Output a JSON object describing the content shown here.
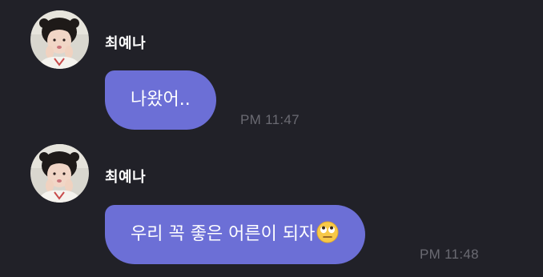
{
  "messages": [
    {
      "sender": "최예나",
      "text": "나왔어..",
      "time": "PM 11:47",
      "avatar_icon": "profile-photo-avatar"
    },
    {
      "sender": "최예나",
      "text": "우리 꼭 좋은 어른이 되자",
      "emoji_icon": "face-with-rolling-eyes-emoji",
      "time": "PM 11:48",
      "avatar_icon": "profile-photo-avatar"
    }
  ],
  "colors": {
    "background": "#212128",
    "bubble": "#6c6fd6",
    "sender_text": "#ffffff",
    "time_text": "#6a6a72"
  }
}
